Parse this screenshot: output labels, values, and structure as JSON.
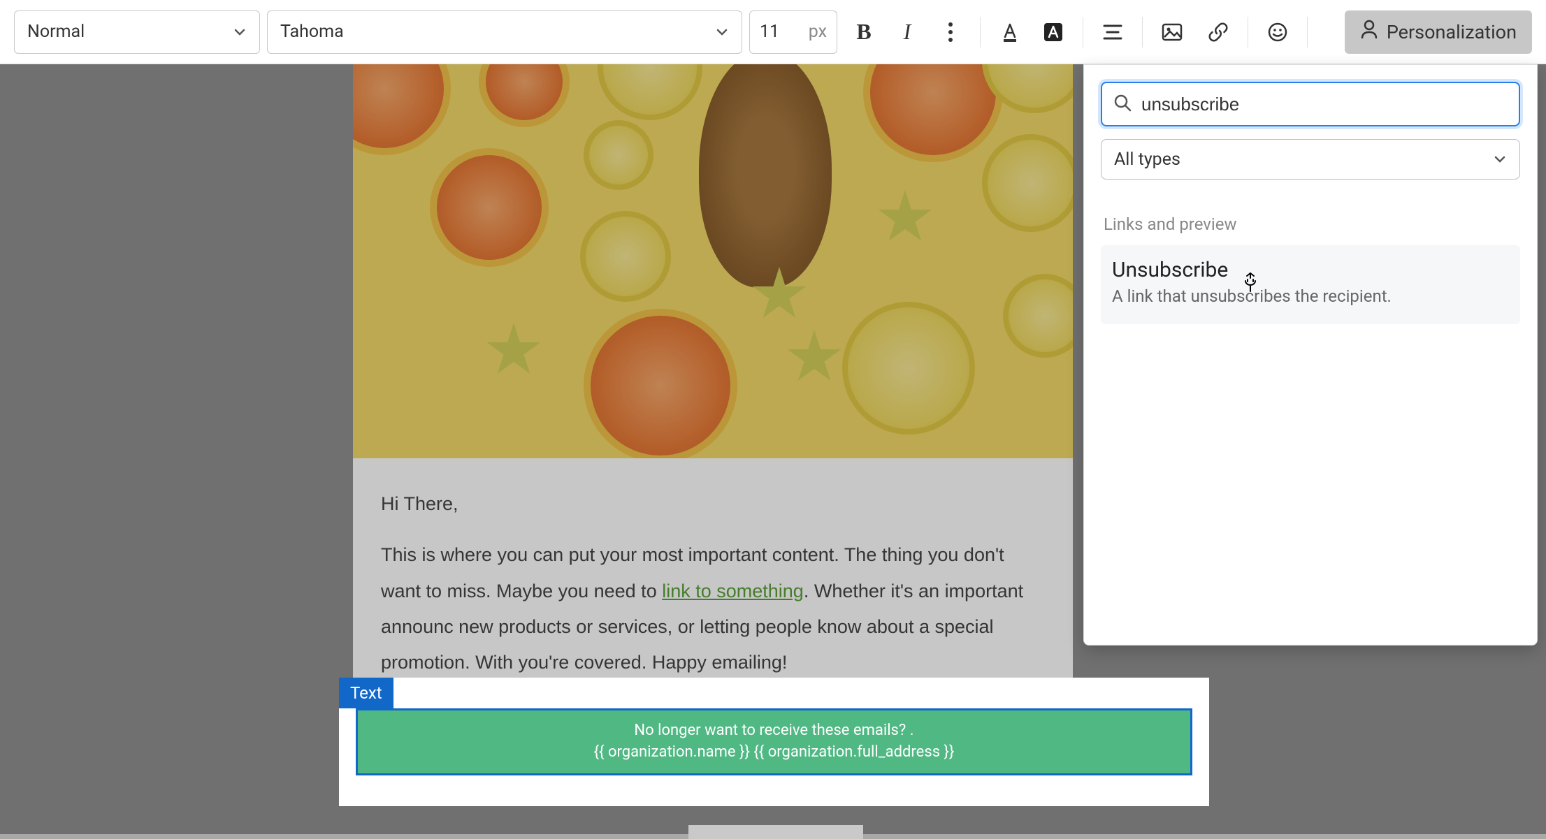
{
  "toolbar": {
    "style": "Normal",
    "font": "Tahoma",
    "fontsize": "11",
    "fontsize_unit": "px",
    "personalization": "Personalization"
  },
  "email": {
    "greeting": "Hi There,",
    "body_before_link": "This is where you can put your most important content. The thing you don't want to miss. Maybe you need to ",
    "link_text": "link to something",
    "body_after_link": ". Whether it's an important announc new products or services, or letting people know about a special promotion. With you're covered. Happy emailing!"
  },
  "text_block": {
    "label": "Text",
    "footer_line1": "No longer want to receive these emails? .",
    "footer_line2": "{{ organization.name }} {{ organization.full_address }}"
  },
  "panel": {
    "search_value": "unsubscribe",
    "type_filter": "All types",
    "section": "Links and preview",
    "result": {
      "title": "Unsubscribe",
      "desc": "A link that unsubscribes the recipient."
    }
  }
}
